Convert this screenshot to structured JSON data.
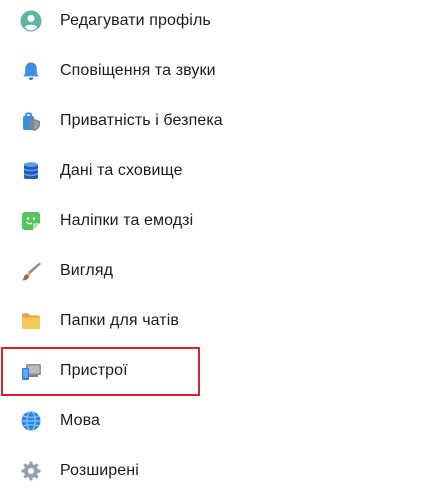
{
  "menu": {
    "items": [
      {
        "label": "Редагувати профіль",
        "icon": "person-icon"
      },
      {
        "label": "Сповіщення та звуки",
        "icon": "bell-icon"
      },
      {
        "label": "Приватність і безпека",
        "icon": "privacy-shield-icon"
      },
      {
        "label": "Дані та сховище",
        "icon": "database-icon"
      },
      {
        "label": "Наліпки та емодзі",
        "icon": "sticker-icon"
      },
      {
        "label": "Вигляд",
        "icon": "brush-icon"
      },
      {
        "label": "Папки для чатів",
        "icon": "folder-icon"
      },
      {
        "label": "Пристрої",
        "icon": "devices-icon"
      },
      {
        "label": "Мова",
        "icon": "globe-icon"
      },
      {
        "label": "Розширені",
        "icon": "gear-icon"
      }
    ],
    "highlighted_item": "Пристрої"
  },
  "colors": {
    "highlight_border": "#d8232a",
    "text": "#1c1c1c"
  }
}
